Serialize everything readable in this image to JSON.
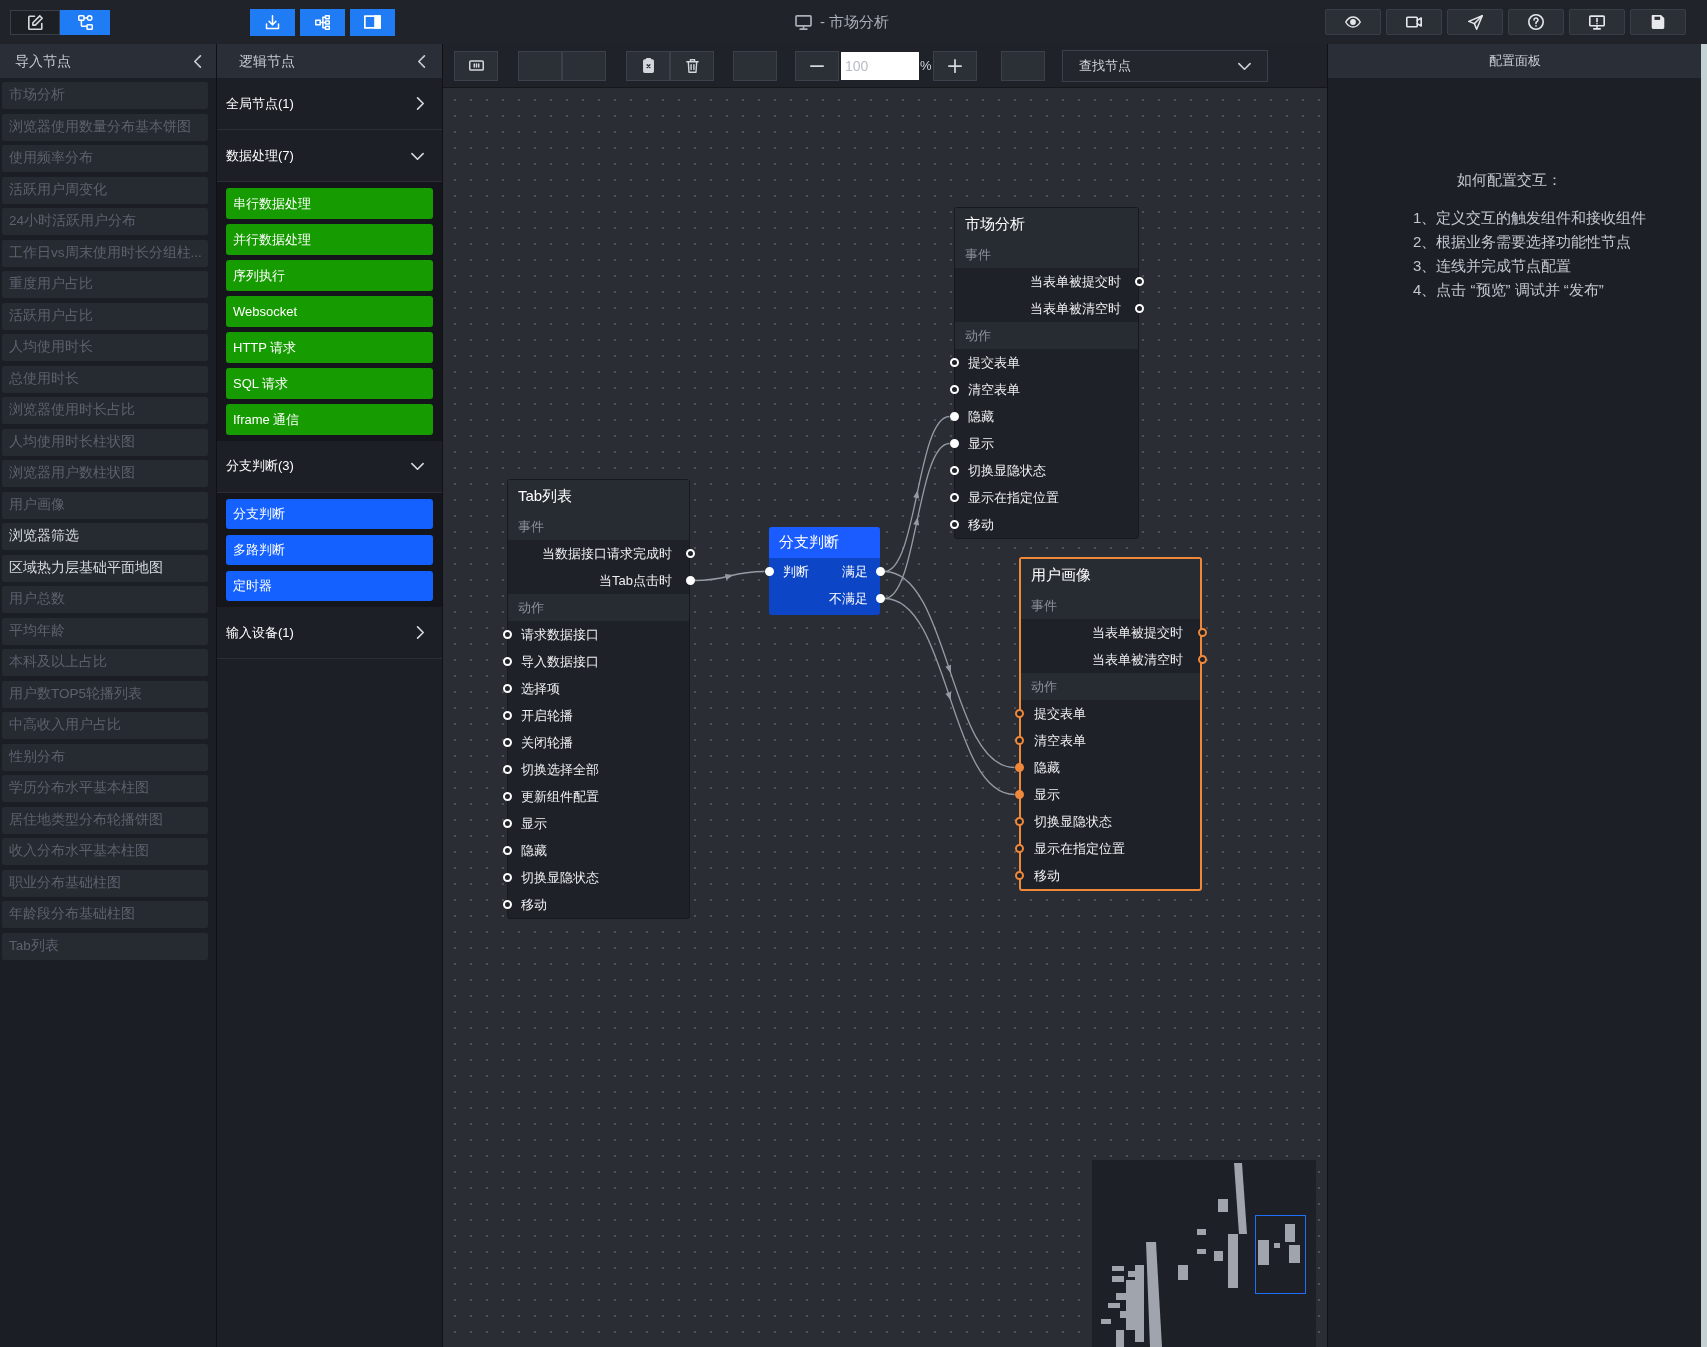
{
  "mode_switch": [
    {
      "selected": false
    },
    {
      "selected": true
    }
  ],
  "window": {
    "title": "- 市场分析"
  },
  "import_panel": {
    "title": "导入节点",
    "items": [
      {
        "label": "市场分析",
        "disabled": true
      },
      {
        "label": "浏览器使用数量分布基本饼图",
        "disabled": true
      },
      {
        "label": "使用频率分布",
        "disabled": true
      },
      {
        "label": "活跃用户周变化",
        "disabled": true
      },
      {
        "label": "24小时活跃用户分布",
        "disabled": true
      },
      {
        "label": "工作日vs周末使用时长分组柱...",
        "disabled": true
      },
      {
        "label": "重度用户占比",
        "disabled": true
      },
      {
        "label": "活跃用户占比",
        "disabled": true
      },
      {
        "label": "人均使用时长",
        "disabled": true
      },
      {
        "label": "总使用时长",
        "disabled": true
      },
      {
        "label": "浏览器使用时长占比",
        "disabled": true
      },
      {
        "label": "人均使用时长柱状图",
        "disabled": true
      },
      {
        "label": "浏览器用户数柱状图",
        "disabled": true
      },
      {
        "label": "用户画像",
        "disabled": true
      },
      {
        "label": "浏览器筛选",
        "disabled": false
      },
      {
        "label": "区域热力层基础平面地图",
        "disabled": false
      },
      {
        "label": "用户总数",
        "disabled": true
      },
      {
        "label": "平均年龄",
        "disabled": true
      },
      {
        "label": "本科及以上占比",
        "disabled": true
      },
      {
        "label": "用户数TOP5轮播列表",
        "disabled": true
      },
      {
        "label": "中高收入用户占比",
        "disabled": true
      },
      {
        "label": "性别分布",
        "disabled": true
      },
      {
        "label": "学历分布水平基本柱图",
        "disabled": true
      },
      {
        "label": "居住地类型分布轮播饼图",
        "disabled": true
      },
      {
        "label": "收入分布水平基本柱图",
        "disabled": true
      },
      {
        "label": "职业分布基础柱图",
        "disabled": true
      },
      {
        "label": "年龄段分布基础柱图",
        "disabled": true
      },
      {
        "label": "Tab列表",
        "disabled": true
      }
    ]
  },
  "logic_panel": {
    "title": "逻辑节点",
    "groups": [
      {
        "label": "全局节点(1)",
        "expanded": false
      },
      {
        "label": "数据处理(7)",
        "expanded": true,
        "color": "#169c00",
        "items": [
          "串行数据处理",
          "并行数据处理",
          "序列执行",
          "Websocket",
          "HTTP 请求",
          "SQL 请求",
          "Iframe 通信"
        ]
      },
      {
        "label": "分支判断(3)",
        "expanded": true,
        "color": "#1461ff",
        "items": [
          "分支判断",
          "多路判断",
          "定时器"
        ]
      },
      {
        "label": "输入设备(1)",
        "expanded": false
      }
    ]
  },
  "canvas_toolbar": {
    "zoom": {
      "placeholder": "100",
      "unit": "%"
    },
    "search": {
      "placeholder": "查找节点"
    }
  },
  "nodes": [
    {
      "kind": "component",
      "title": "市场分析",
      "selected": false,
      "events_label": "事件",
      "events": [
        {
          "label": "当表单被提交时",
          "connected": false
        },
        {
          "label": "当表单被清空时",
          "connected": false
        }
      ],
      "actions_label": "动作",
      "actions": [
        {
          "label": "提交表单",
          "connected": false
        },
        {
          "label": "清空表单",
          "connected": false
        },
        {
          "label": "隐藏",
          "connected": true
        },
        {
          "label": "显示",
          "connected": true
        },
        {
          "label": "切换显隐状态",
          "connected": false
        },
        {
          "label": "显示在指定位置",
          "connected": false
        },
        {
          "label": "移动",
          "connected": false
        }
      ]
    },
    {
      "kind": "component",
      "title": "Tab列表",
      "selected": false,
      "events_label": "事件",
      "events": [
        {
          "label": "当数据接口请求完成时",
          "connected": false
        },
        {
          "label": "当Tab点击时",
          "connected": true
        }
      ],
      "actions_label": "动作",
      "actions": [
        {
          "label": "请求数据接口",
          "connected": false
        },
        {
          "label": "导入数据接口",
          "connected": false
        },
        {
          "label": "选择项",
          "connected": false
        },
        {
          "label": "开启轮播",
          "connected": false
        },
        {
          "label": "关闭轮播",
          "connected": false
        },
        {
          "label": "切换选择全部",
          "connected": false
        },
        {
          "label": "更新组件配置",
          "connected": false
        },
        {
          "label": "显示",
          "connected": false
        },
        {
          "label": "隐藏",
          "connected": false
        },
        {
          "label": "切换显隐状态",
          "connected": false
        },
        {
          "label": "移动",
          "connected": false
        }
      ]
    },
    {
      "kind": "branch",
      "title": "分支判断",
      "selected": false,
      "inputs": [
        {
          "label": "判断",
          "connected": true
        }
      ],
      "outputs": [
        {
          "label": "满足",
          "connected": true
        },
        {
          "label": "不满足",
          "connected": true
        }
      ]
    },
    {
      "kind": "component",
      "title": "用户画像",
      "selected": true,
      "events_label": "事件",
      "events": [
        {
          "label": "当表单被提交时",
          "connected": false
        },
        {
          "label": "当表单被清空时",
          "connected": false
        }
      ],
      "actions_label": "动作",
      "actions": [
        {
          "label": "提交表单",
          "connected": false
        },
        {
          "label": "清空表单",
          "connected": false
        },
        {
          "label": "隐藏",
          "connected": true
        },
        {
          "label": "显示",
          "connected": true
        },
        {
          "label": "切换显隐状态",
          "connected": false
        },
        {
          "label": "显示在指定位置",
          "connected": false
        },
        {
          "label": "移动",
          "connected": false
        }
      ]
    }
  ],
  "config_panel": {
    "title": "配置面板",
    "help_title": "如何配置交互：",
    "steps": [
      "1、定义交互的触发组件和接收组件",
      "2、根据业务需要选择功能性节点",
      "3、连线并完成节点配置",
      "4、点击 “预览” 调试并 “发布”"
    ]
  }
}
